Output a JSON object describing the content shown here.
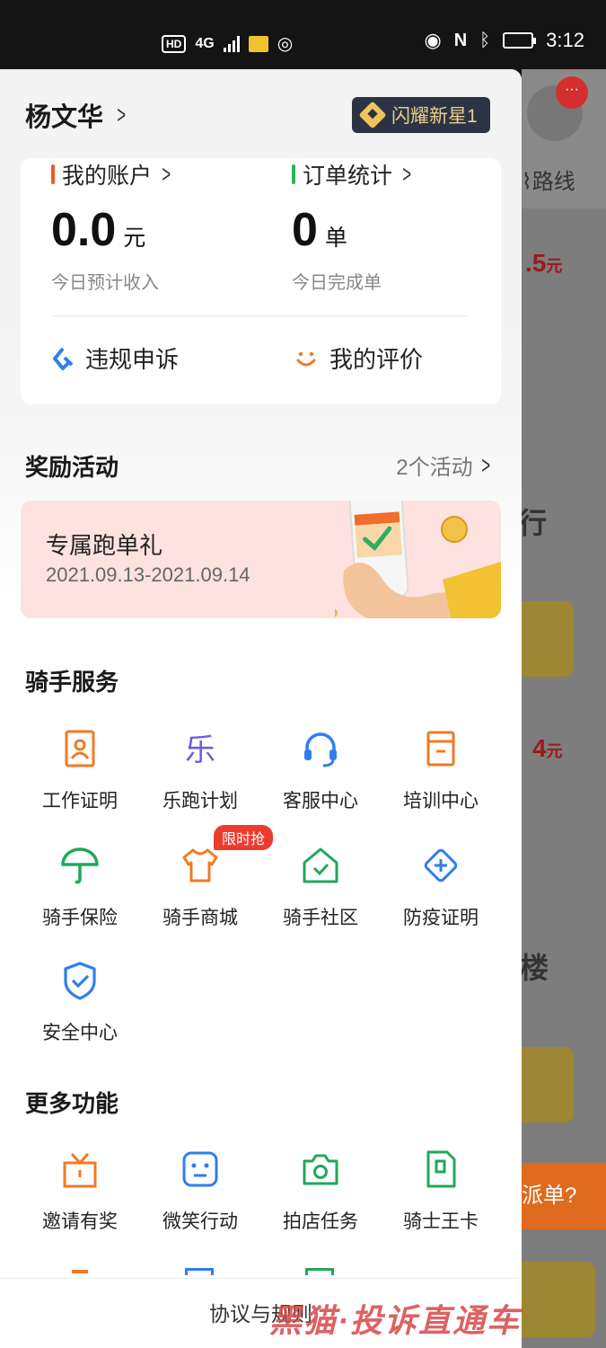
{
  "status_bar": {
    "left_hd": "HD",
    "left_network": "4G",
    "time": "3:12"
  },
  "background_app": {
    "notification_badge": "···",
    "route_label": "路线",
    "price1": ".5",
    "price1_unit": "元",
    "price2": "4",
    "price2_unit": "元",
    "partial_text1": "行",
    "partial_text2": "楼",
    "dispatch_text": "派单?"
  },
  "drawer": {
    "user_name": "杨文华",
    "level_badge": "闪耀新星1",
    "account": {
      "title": "我的账户",
      "value": "0.0",
      "unit": "元",
      "subtitle": "今日预计收入",
      "accent": "#f05a24"
    },
    "orders": {
      "title": "订单统计",
      "value": "0",
      "unit": "单",
      "subtitle": "今日完成单",
      "accent": "#2fae5f"
    },
    "quick_actions": [
      {
        "label": "违规申诉",
        "icon": "appeal-icon"
      },
      {
        "label": "我的评价",
        "icon": "smile-icon"
      }
    ],
    "rewards": {
      "title": "奖励活动",
      "more": "2个活动",
      "promo_title": "专属跑单礼",
      "promo_date": "2021.09.13-2021.09.14"
    },
    "rider_services": {
      "title": "骑手服务",
      "items": [
        {
          "label": "工作证明",
          "icon": "badge-icon"
        },
        {
          "label": "乐跑计划",
          "icon": "le-icon"
        },
        {
          "label": "客服中心",
          "icon": "headset-icon"
        },
        {
          "label": "培训中心",
          "icon": "training-icon"
        },
        {
          "label": "骑手保险",
          "icon": "umbrella-icon"
        },
        {
          "label": "骑手商城",
          "icon": "shirt-icon",
          "tag": "限时抢"
        },
        {
          "label": "骑手社区",
          "icon": "home-icon"
        },
        {
          "label": "防疫证明",
          "icon": "medical-icon"
        },
        {
          "label": "安全中心",
          "icon": "shield-icon"
        }
      ]
    },
    "more_features": {
      "title": "更多功能",
      "items": [
        {
          "label": "邀请有奖",
          "icon": "gift-icon"
        },
        {
          "label": "微笑行动",
          "icon": "smile-face-icon"
        },
        {
          "label": "拍店任务",
          "icon": "camera-icon"
        },
        {
          "label": "骑士王卡",
          "icon": "sim-card-icon"
        }
      ]
    },
    "footer": "协议与规则"
  },
  "watermark": "黑猫·投诉直通车"
}
